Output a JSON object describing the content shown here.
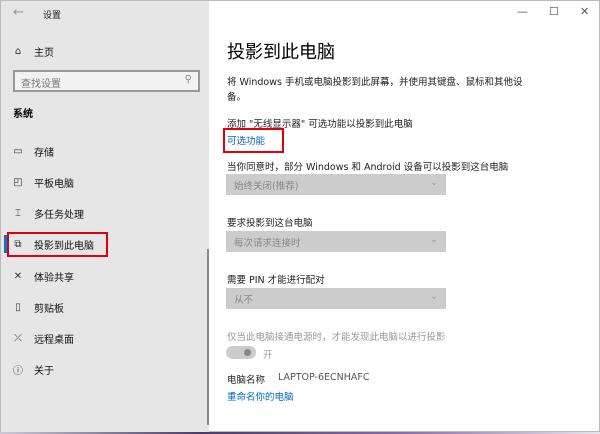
{
  "window": {
    "title": "设置",
    "back_icon": "arrow-left",
    "controls": [
      "minimize",
      "maximize",
      "close"
    ]
  },
  "sidebar": {
    "home": "主页",
    "search_placeholder": "查找设置",
    "section": "系统",
    "items": [
      {
        "label": "存储",
        "icon": "storage-icon"
      },
      {
        "label": "平板电脑",
        "icon": "tablet-icon"
      },
      {
        "label": "多任务处理",
        "icon": "multitask-icon"
      },
      {
        "label": "投影到此电脑",
        "icon": "project-icon",
        "selected": true
      },
      {
        "label": "体验共享",
        "icon": "share-icon"
      },
      {
        "label": "剪贴板",
        "icon": "clipboard-icon"
      },
      {
        "label": "远程桌面",
        "icon": "remote-icon"
      },
      {
        "label": "关于",
        "icon": "info-icon"
      }
    ]
  },
  "main": {
    "title": "投影到此电脑",
    "desc_line1": "将 Windows 手机或电脑投影到此屏幕，并使用其键盘、鼠标和其他设",
    "desc_line2": "备。",
    "add_text": "添加 \"无线显示器\" 可选功能以投影到此电脑",
    "optional_link": "可选功能",
    "label1": "当你同意时，部分 Windows 和 Android 设备可以投影到这台电脑",
    "dropdown1": "始终关闭(推荐)",
    "label2": "要求投影到这台电脑",
    "dropdown2": "每次请求连接时",
    "label3": "需要 PIN 才能进行配对",
    "dropdown3": "从不",
    "power_text": "仅当此电脑接通电源时，才能发现此电脑以进行投影",
    "toggle_label": "开",
    "toggle_on": true,
    "pc_name_label": "电脑名称",
    "pc_name": "LAPTOP-6ECNHAFC",
    "rename_link": "重命名你的电脑"
  },
  "colors": {
    "accent": "#0078d7",
    "highlight": "#e0000b",
    "link": "#0067c0"
  }
}
